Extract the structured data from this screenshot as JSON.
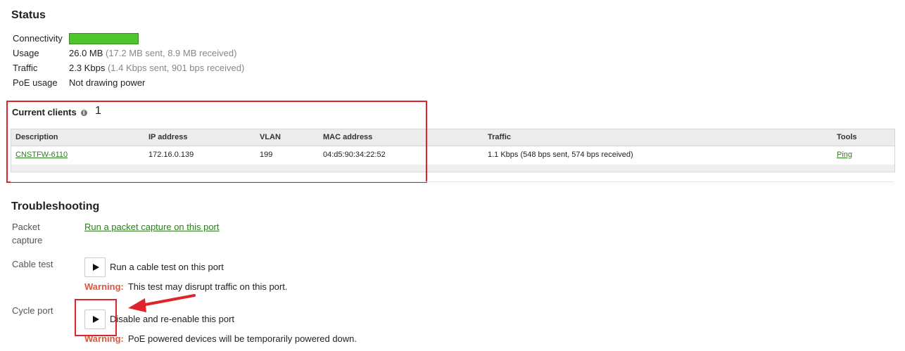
{
  "status": {
    "title": "Status",
    "connectivity_label": "Connectivity",
    "connectivity_color": "#4ec52a",
    "usage_label": "Usage",
    "usage_value": "26.0 MB",
    "usage_detail": "(17.2 MB sent, 8.9 MB received)",
    "traffic_label": "Traffic",
    "traffic_value": "2.3 Kbps",
    "traffic_detail": "(1.4 Kbps sent, 901 bps received)",
    "poe_label": "PoE usage",
    "poe_value": "Not drawing power"
  },
  "clients": {
    "title": "Current clients",
    "info_icon": "info-icon",
    "count": "1",
    "columns": {
      "description": "Description",
      "ip": "IP address",
      "vlan": "VLAN",
      "mac": "MAC address",
      "traffic": "Traffic",
      "tools": "Tools"
    },
    "rows": [
      {
        "description": "CNSTFW-6110",
        "ip": "172.16.0.139",
        "vlan": "199",
        "mac": "04:d5:90:34:22:52",
        "traffic": "1.1 Kbps (548 bps sent, 574 bps received)",
        "tool": "Ping"
      }
    ]
  },
  "troubleshooting": {
    "title": "Troubleshooting",
    "packet_capture_label": "Packet capture",
    "packet_capture_link": "Run a packet capture on this port",
    "cable_test_label": "Cable test",
    "cable_test_button_text": "Run a cable test on this port",
    "cable_test_warning_label": "Warning:",
    "cable_test_warning_text": "This test may disrupt traffic on this port.",
    "cycle_port_label": "Cycle port",
    "cycle_port_button_text": "Disable and re-enable this port",
    "cycle_port_warning_label": "Warning:",
    "cycle_port_warning_text": "PoE powered devices will be temporarily powered down."
  },
  "annotations": {
    "highlight_color": "#e0242b"
  }
}
